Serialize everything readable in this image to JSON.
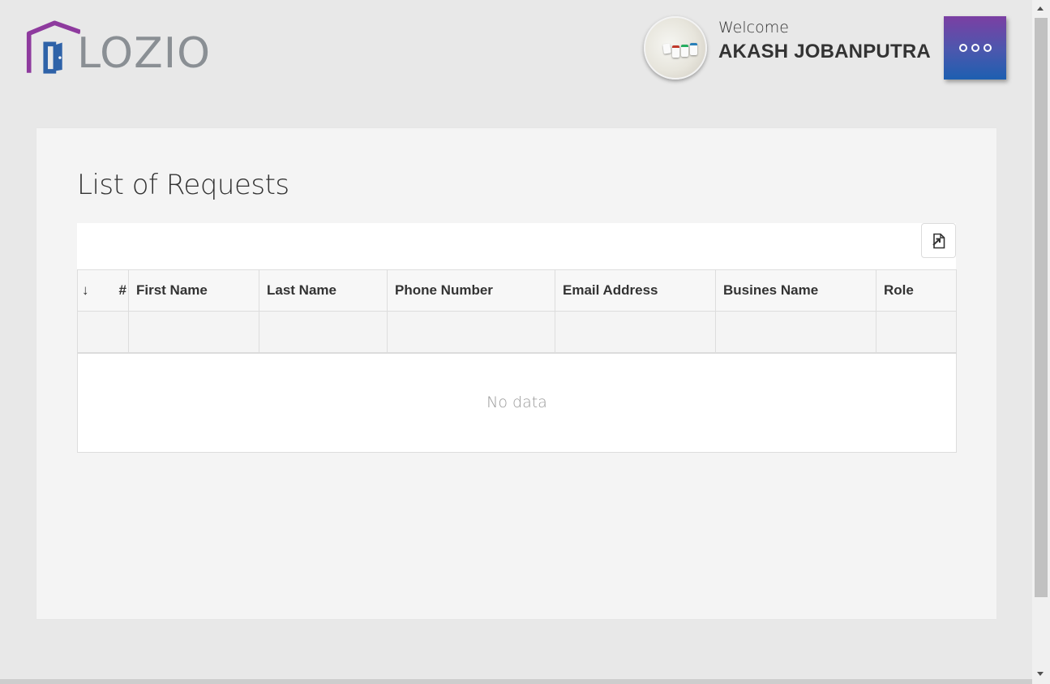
{
  "header": {
    "logo_text": "LOZIO",
    "welcome_label": "Welcome",
    "user_name": "AKASH JOBANPUTRA",
    "menu_icon": "more-dots-icon",
    "brand_colors": {
      "purple": "#8e3a9e",
      "blue": "#2e62a8",
      "gray": "#8a8f94"
    }
  },
  "main": {
    "title": "List of Requests",
    "export_icon": "export-file-icon",
    "table": {
      "sort_symbol": "↓",
      "index_symbol": "#",
      "columns": [
        "First Name",
        "Last Name",
        "Phone Number",
        "Email Address",
        "Busines Name",
        "Role"
      ],
      "rows": [],
      "empty_text": "No data"
    }
  }
}
